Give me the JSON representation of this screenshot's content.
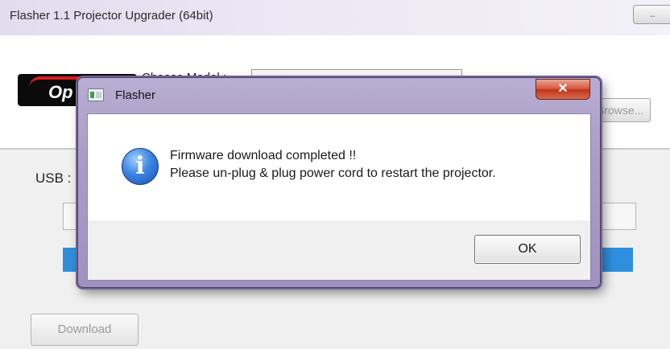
{
  "main_window": {
    "title": "Flasher 1.1 Projector Upgrader (64bit)",
    "title_control_label": "..",
    "logo_text": "Op",
    "model_label": "Choose Model :",
    "model_value": "",
    "browse_label": "Browse...",
    "usb_label": "USB :",
    "firmware_path": "",
    "progress_percent": 100,
    "download_label": "Download"
  },
  "dialog": {
    "title": "Flasher",
    "close_label": "✕",
    "icon": "info-icon",
    "message_line1": "Firmware download completed !!",
    "message_line2": "Please un-plug & plug power cord to restart the projector.",
    "ok_label": "OK"
  },
  "colors": {
    "dialog_frame": "#a99cc6",
    "close_button": "#c0341b",
    "progress_fill": "#2f8fde",
    "logo_swoosh": "#d81c1c"
  }
}
